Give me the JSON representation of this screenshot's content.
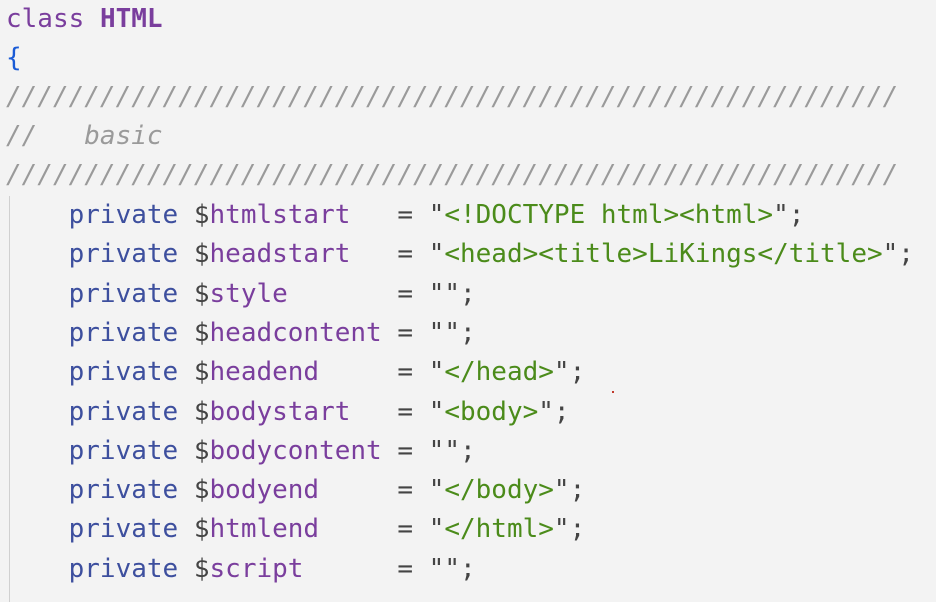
{
  "editor": {
    "class_line": {
      "keyword": "class",
      "name": "HTML"
    },
    "open_brace": "{",
    "comment_rule": "/////////////////////////////////////////////////////////",
    "comment_text": "//   basic",
    "members": [
      {
        "keyword": "private",
        "dollar": "$",
        "name": "htmlstart",
        "pad": "   ",
        "op": "=",
        "value": "\"<!DOCTYPE html><html>\"",
        "end": ";"
      },
      {
        "keyword": "private",
        "dollar": "$",
        "name": "headstart",
        "pad": "   ",
        "op": "=",
        "value": "\"<head><title>LiKings</title>\"",
        "end": ";"
      },
      {
        "keyword": "private",
        "dollar": "$",
        "name": "style",
        "pad": "       ",
        "op": "=",
        "value": "\"\"",
        "end": ";"
      },
      {
        "keyword": "private",
        "dollar": "$",
        "name": "headcontent",
        "pad": " ",
        "op": "=",
        "value": "\"\"",
        "end": ";"
      },
      {
        "keyword": "private",
        "dollar": "$",
        "name": "headend",
        "pad": "     ",
        "op": "=",
        "value": "\"</head>\"",
        "end": ";"
      },
      {
        "keyword": "private",
        "dollar": "$",
        "name": "bodystart",
        "pad": "   ",
        "op": "=",
        "value": "\"<body>\"",
        "end": ";"
      },
      {
        "keyword": "private",
        "dollar": "$",
        "name": "bodycontent",
        "pad": " ",
        "op": "=",
        "value": "\"\"",
        "end": ";"
      },
      {
        "keyword": "private",
        "dollar": "$",
        "name": "bodyend",
        "pad": "     ",
        "op": "=",
        "value": "\"</body>\"",
        "end": ";"
      },
      {
        "keyword": "private",
        "dollar": "$",
        "name": "htmlend",
        "pad": "     ",
        "op": "=",
        "value": "\"</html>\"",
        "end": ";"
      },
      {
        "keyword": "private",
        "dollar": "$",
        "name": "script",
        "pad": "      ",
        "op": "=",
        "value": "\"\"",
        "end": ";"
      }
    ]
  },
  "colors": {
    "background": "#f3f3f3",
    "keyword": "#3d4f9e",
    "class_keyword": "#7a3e9d",
    "variable": "#7a3e9d",
    "string": "#4b8b1a",
    "comment": "#9a9a9a",
    "brace": "#1a5bd6"
  }
}
